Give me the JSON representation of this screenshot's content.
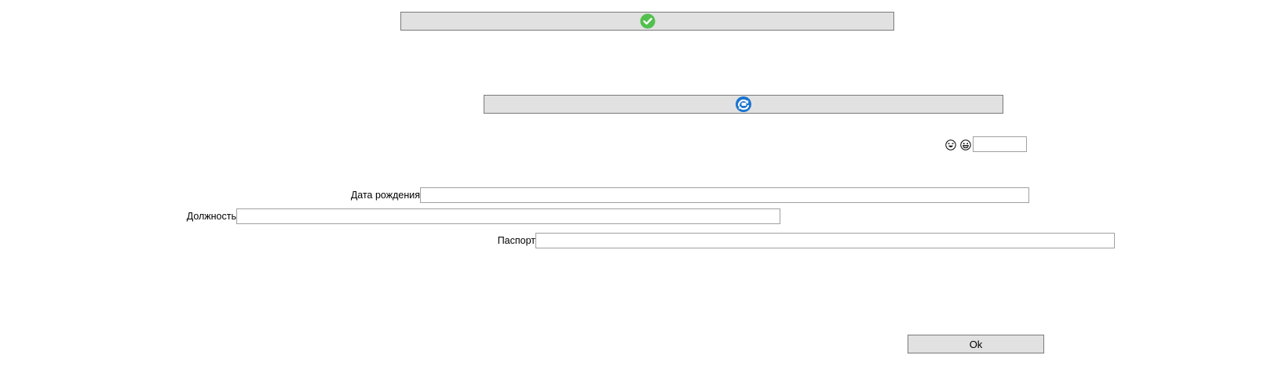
{
  "buttons": {
    "confirm_icon": "check-circle-icon",
    "refresh_icon": "refresh-icon",
    "ok_label": "Ok"
  },
  "emojis": [
    "laughing-emoji-icon",
    "grinning-emoji-icon"
  ],
  "form": {
    "birth_date_label": "Дата рождения",
    "birth_date_value": "",
    "position_label": "Должность",
    "position_value": "",
    "passport_label": "Паспорт",
    "passport_value": "",
    "small_value": ""
  },
  "colors": {
    "button_bg": "#e1e1e1",
    "button_border": "#7a7a7a",
    "check_green": "#52c04e",
    "refresh_blue": "#1a74d0",
    "field_border": "#a0a0a0"
  }
}
